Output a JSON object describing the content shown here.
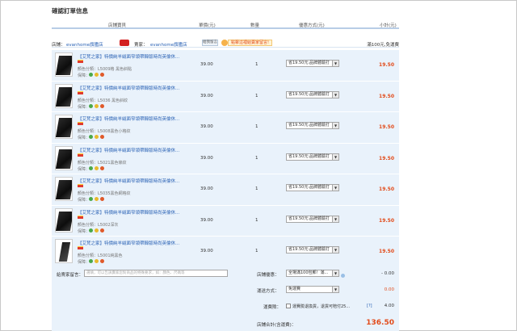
{
  "page_title": "確認訂單信息",
  "columns": {
    "item": "店鋪寶貝",
    "price": "單價(元)",
    "qty": "數量",
    "shipping": "優惠方式(元)",
    "subtotal": "小計(元)"
  },
  "shop": {
    "shop_label": "店鋪：",
    "shop_name": "evanhome旗艦店",
    "seller_label": "賣家：",
    "seller_name": "evanhome旗艦店",
    "message_button": "給我留言",
    "promo_text": "點擊這裡給賣家留言!",
    "free_shipping": "滿100元,免運費"
  },
  "items": [
    {
      "name": "【艾梵之家】特價純羊絨面窄領帶韓版時尚英倫休...",
      "spec_label": "顏色分類：",
      "spec_value": "L5009格 黑色斜點",
      "guarantee_label": "保障：",
      "price": "39.00",
      "qty": "1",
      "shipping": "省19.50元:品牌體驗打",
      "subtotal": "19.50"
    },
    {
      "name": "【艾梵之家】特價純羊絨面窄領帶韓版時尚英倫休...",
      "spec_label": "顏色分類：",
      "spec_value": "L5036 黑色斜紋",
      "guarantee_label": "保障：",
      "price": "39.00",
      "qty": "1",
      "shipping": "省19.50元:品牌體驗打",
      "subtotal": "19.50"
    },
    {
      "name": "【艾梵之家】特價純羊絨面窄領帶韓版時尚英倫休...",
      "spec_label": "顏色分類：",
      "spec_value": "L5008黑色小格紋",
      "guarantee_label": "保障：",
      "price": "39.00",
      "qty": "1",
      "shipping": "省19.50元:品牌體驗打",
      "subtotal": "19.50"
    },
    {
      "name": "【艾梵之家】特價純羊絨面窄領帶韓版時尚英倫休...",
      "spec_label": "顏色分類：",
      "spec_value": "L5021黑色條紋",
      "guarantee_label": "保障：",
      "price": "39.00",
      "qty": "1",
      "shipping": "省19.50元:品牌體驗打",
      "subtotal": "19.50"
    },
    {
      "name": "【艾梵之家】特價純羊絨面窄領帶韓版時尚英倫休...",
      "spec_label": "顏色分類：",
      "spec_value": "L5035黑色網格紋",
      "guarantee_label": "保障：",
      "price": "39.00",
      "qty": "1",
      "shipping": "省19.50元:品牌體驗打",
      "subtotal": "19.50"
    },
    {
      "name": "【艾梵之家】特價純羊絨面窄領帶韓版時尚英倫休...",
      "spec_label": "顏色分類：",
      "spec_value": "L5002深灰",
      "guarantee_label": "保障：",
      "price": "39.00",
      "qty": "1",
      "shipping": "省19.50元:品牌體驗打",
      "subtotal": "19.50"
    },
    {
      "name": "【艾梵之家】特價純羊絨面窄領帶韓版時尚英倫休...",
      "spec_label": "顏色分類：",
      "spec_value": "L5001純黑色",
      "guarantee_label": "保障：",
      "price": "39.00",
      "qty": "1",
      "shipping": "省19.50元:品牌體驗打",
      "subtotal": "19.50"
    }
  ],
  "footer": {
    "message_label": "給賣家留言：",
    "message_placeholder": "選填，可以告訴賣家您對商品的特殊要求，如：顏色、尺碼等",
    "shop_discount_label": "店鋪優惠：",
    "shop_discount_value": "全場滿100包郵！滿...",
    "shop_discount_amount": "- 0.00",
    "shipping_method_label": "運送方式：",
    "shipping_method_value": "免運費",
    "shipping_amount": "0.00",
    "insurance_label": "運費險：",
    "insurance_text": "運費險退換貨，退貨可賠付25...",
    "insurance_help": "[?]",
    "insurance_amount": "4.00",
    "total_label": "店鋪合計(含運費)：",
    "total_value": "136.50"
  },
  "colors": {
    "accent_red": "#e24b1a",
    "link_blue": "#2a62b5",
    "row_bg": "#e9f2fb"
  }
}
